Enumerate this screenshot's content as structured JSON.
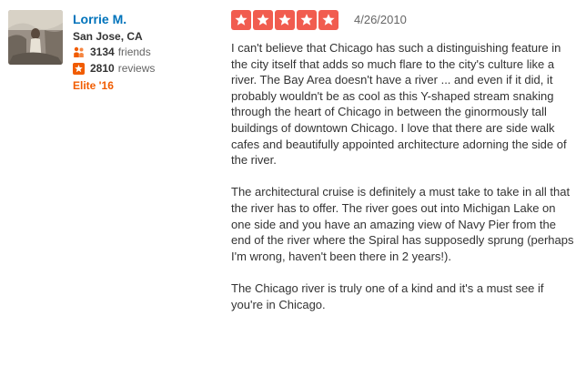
{
  "user": {
    "name": "Lorrie M.",
    "location": "San Jose, CA",
    "friends_count": "3134",
    "friends_label": "friends",
    "reviews_count": "2810",
    "reviews_label": "reviews",
    "elite_badge": "Elite '16"
  },
  "review": {
    "rating": 5,
    "rating_max": 5,
    "date": "4/26/2010",
    "paragraphs": [
      "I can't believe that Chicago has such a distinguishing feature in the city itself that adds so much flare to the city's culture like a river. The Bay Area doesn't have a river ... and even if it did, it probably wouldn't be as cool as this Y-shaped stream snaking through the heart of Chicago in between the ginormously tall buildings of downtown Chicago. I love that there are side walk cafes and beautifully appointed architecture adorning the side of the river.",
      "The architectural cruise is definitely a must take to take in all that the river has to offer. The river goes out into Michigan Lake on one side and you have an amazing view of Navy Pier from the end of the river where the Spiral has supposedly sprung (perhaps I'm wrong, haven't been there in 2 years!).",
      "The Chicago river is truly one of a kind and it's a must see if you're in Chicago."
    ]
  },
  "colors": {
    "star_fill": "#f15c4f",
    "user_link": "#0073bb",
    "elite": "#f15c00",
    "friends_icon": "#f15c00",
    "reviews_icon": "#f15c00"
  },
  "icons": {
    "friends": "friends-icon",
    "reviews": "review-star-icon",
    "rating_star": "star-icon"
  }
}
